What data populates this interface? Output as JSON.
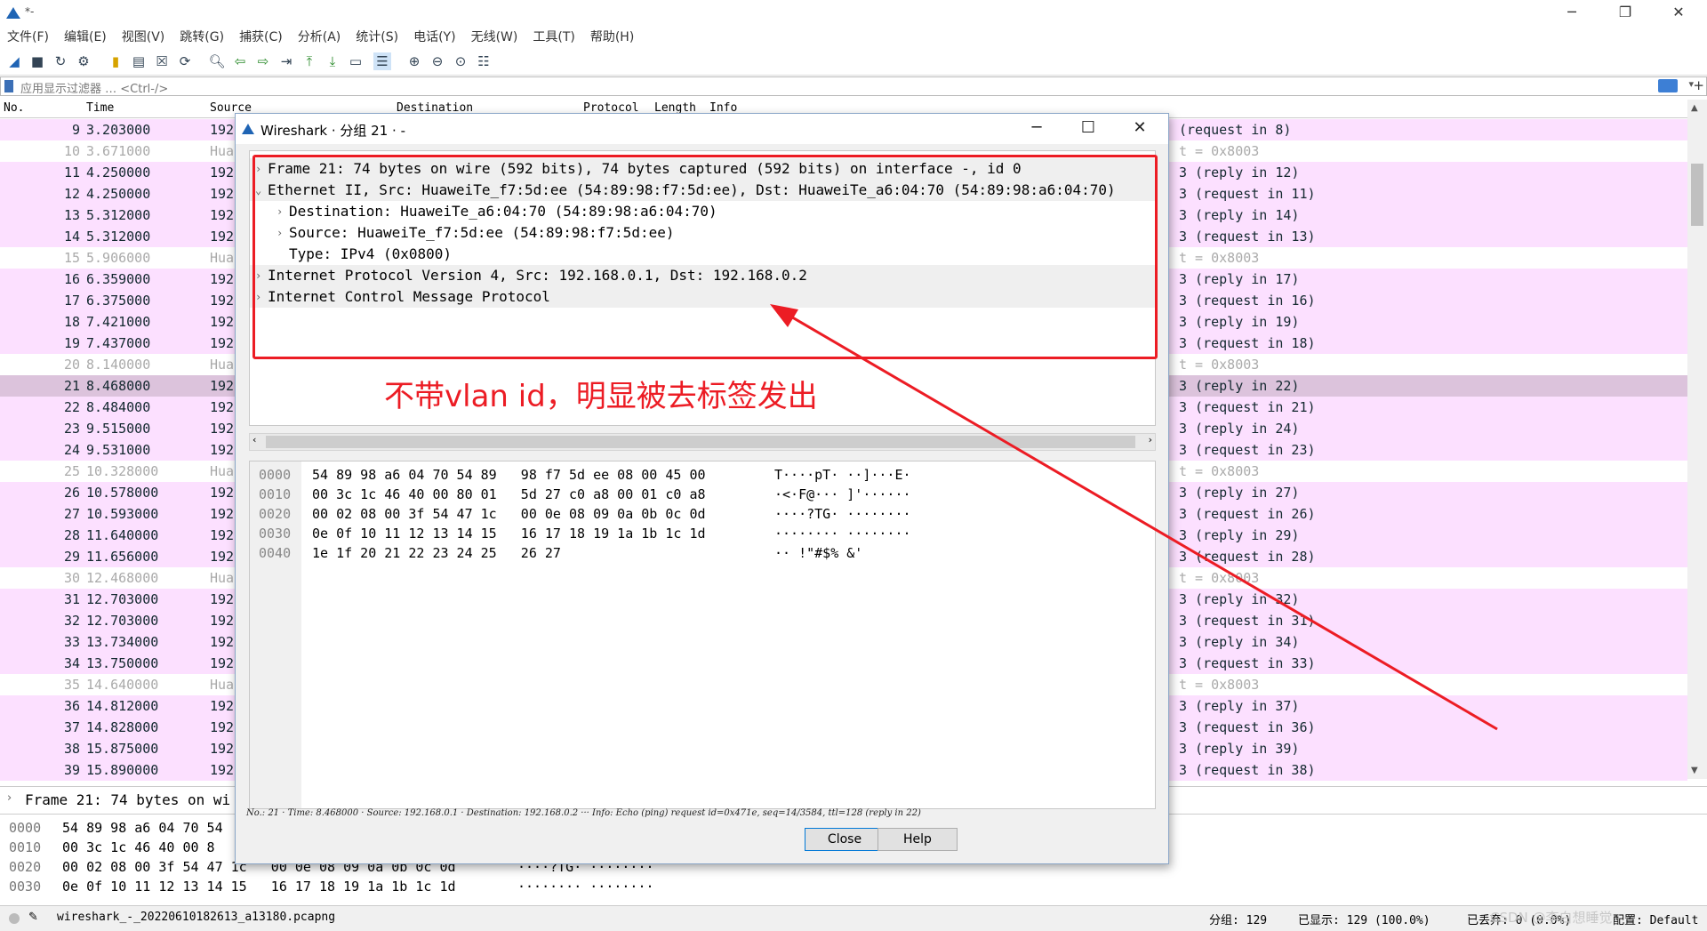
{
  "window": {
    "title": "*-"
  },
  "menu": [
    "文件(F)",
    "编辑(E)",
    "视图(V)",
    "跳转(G)",
    "捕获(C)",
    "分析(A)",
    "统计(S)",
    "电话(Y)",
    "无线(W)",
    "工具(T)",
    "帮助(H)"
  ],
  "filter": {
    "placeholder": "应用显示过滤器 … <Ctrl-/>"
  },
  "columns": [
    "No.",
    "Time",
    "Source",
    "Destination",
    "Protocol",
    "Length",
    "Info"
  ],
  "packets": [
    {
      "no": "9",
      "time": "3.203000",
      "src": "192",
      "info": "(request in 8)",
      "kind": "icmp"
    },
    {
      "no": "10",
      "time": "3.671000",
      "src": "Hua",
      "info": "t = 0x8003",
      "kind": "other"
    },
    {
      "no": "11",
      "time": "4.250000",
      "src": "192",
      "info": "3 (reply in 12)",
      "kind": "icmp"
    },
    {
      "no": "12",
      "time": "4.250000",
      "src": "192",
      "info": "3 (request in 11)",
      "kind": "icmp"
    },
    {
      "no": "13",
      "time": "5.312000",
      "src": "192",
      "info": "3 (reply in 14)",
      "kind": "icmp"
    },
    {
      "no": "14",
      "time": "5.312000",
      "src": "192",
      "info": "3 (request in 13)",
      "kind": "icmp"
    },
    {
      "no": "15",
      "time": "5.906000",
      "src": "Hua",
      "info": "t = 0x8003",
      "kind": "other"
    },
    {
      "no": "16",
      "time": "6.359000",
      "src": "192",
      "info": "3 (reply in 17)",
      "kind": "icmp"
    },
    {
      "no": "17",
      "time": "6.375000",
      "src": "192",
      "info": "3 (request in 16)",
      "kind": "icmp"
    },
    {
      "no": "18",
      "time": "7.421000",
      "src": "192",
      "info": "3 (reply in 19)",
      "kind": "icmp"
    },
    {
      "no": "19",
      "time": "7.437000",
      "src": "192",
      "info": "3 (request in 18)",
      "kind": "icmp"
    },
    {
      "no": "20",
      "time": "8.140000",
      "src": "Hua",
      "info": "t = 0x8003",
      "kind": "other"
    },
    {
      "no": "21",
      "time": "8.468000",
      "src": "192",
      "info": "3 (reply in 22)",
      "kind": "sel"
    },
    {
      "no": "22",
      "time": "8.484000",
      "src": "192",
      "info": "3 (request in 21)",
      "kind": "icmp"
    },
    {
      "no": "23",
      "time": "9.515000",
      "src": "192",
      "info": "3 (reply in 24)",
      "kind": "icmp"
    },
    {
      "no": "24",
      "time": "9.531000",
      "src": "192",
      "info": "3 (request in 23)",
      "kind": "icmp"
    },
    {
      "no": "25",
      "time": "10.328000",
      "src": "Hua",
      "info": "t = 0x8003",
      "kind": "other"
    },
    {
      "no": "26",
      "time": "10.578000",
      "src": "192",
      "info": "3 (reply in 27)",
      "kind": "icmp"
    },
    {
      "no": "27",
      "time": "10.593000",
      "src": "192",
      "info": "3 (request in 26)",
      "kind": "icmp"
    },
    {
      "no": "28",
      "time": "11.640000",
      "src": "192",
      "info": "3 (reply in 29)",
      "kind": "icmp"
    },
    {
      "no": "29",
      "time": "11.656000",
      "src": "192",
      "info": "3 (request in 28)",
      "kind": "icmp"
    },
    {
      "no": "30",
      "time": "12.468000",
      "src": "Hua",
      "info": "t = 0x8003",
      "kind": "other"
    },
    {
      "no": "31",
      "time": "12.703000",
      "src": "192",
      "info": "3 (reply in 32)",
      "kind": "icmp"
    },
    {
      "no": "32",
      "time": "12.703000",
      "src": "192",
      "info": "3 (request in 31)",
      "kind": "icmp"
    },
    {
      "no": "33",
      "time": "13.734000",
      "src": "192",
      "info": "3 (reply in 34)",
      "kind": "icmp"
    },
    {
      "no": "34",
      "time": "13.750000",
      "src": "192",
      "info": "3 (request in 33)",
      "kind": "icmp"
    },
    {
      "no": "35",
      "time": "14.640000",
      "src": "Hua",
      "info": "t = 0x8003",
      "kind": "other"
    },
    {
      "no": "36",
      "time": "14.812000",
      "src": "192",
      "info": "3 (reply in 37)",
      "kind": "icmp"
    },
    {
      "no": "37",
      "time": "14.828000",
      "src": "192",
      "info": "3 (request in 36)",
      "kind": "icmp"
    },
    {
      "no": "38",
      "time": "15.875000",
      "src": "192",
      "info": "3 (reply in 39)",
      "kind": "icmp"
    },
    {
      "no": "39",
      "time": "15.890000",
      "src": "192",
      "info": "3 (request in 38)",
      "kind": "icmp"
    }
  ],
  "detail": {
    "summary": "Frame 21: 74 bytes on wi"
  },
  "bytes": [
    {
      "off": "0000",
      "hex": "54 89 98 a6 04 70 54",
      "asc": ""
    },
    {
      "off": "0010",
      "hex": "00 3c 1c 46 40 00 8",
      "asc": ""
    },
    {
      "off": "0020",
      "hex": "00 02 08 00 3f 54 47 1c   00 0e 08 09 0a 0b 0c 0d",
      "asc": "····?TG· ········"
    },
    {
      "off": "0030",
      "hex": "0e 0f 10 11 12 13 14 15   16 17 18 19 1a 1b 1c 1d",
      "asc": "········ ········"
    }
  ],
  "status": {
    "file": "wireshark_-_20220610182613_a13180.pcapng",
    "packets": "分组: 129",
    "displayed": "已显示: 129 (100.0%)",
    "dropped": "已丢弃: 0 (0.0%)",
    "profile": "配置: Default",
    "watermark": "CSDN @李白想睡觉"
  },
  "dialog": {
    "title": "Wireshark · 分组 21 · -",
    "tree": [
      {
        "text": "Frame 21: 74 bytes on wire (592 bits), 74 bytes captured (592 bits) on interface -, id 0",
        "indent": 0,
        "expander": "›",
        "top": true
      },
      {
        "text": "Ethernet II, Src: HuaweiTe_f7:5d:ee (54:89:98:f7:5d:ee), Dst: HuaweiTe_a6:04:70 (54:89:98:a6:04:70)",
        "indent": 0,
        "expander": "⌄",
        "top": true
      },
      {
        "text": "Destination: HuaweiTe_a6:04:70 (54:89:98:a6:04:70)",
        "indent": 1,
        "expander": "›",
        "top": false
      },
      {
        "text": "Source: HuaweiTe_f7:5d:ee (54:89:98:f7:5d:ee)",
        "indent": 1,
        "expander": "›",
        "top": false
      },
      {
        "text": "Type: IPv4 (0x0800)",
        "indent": 1,
        "expander": "",
        "top": false
      },
      {
        "text": "Internet Protocol Version 4, Src: 192.168.0.1, Dst: 192.168.0.2",
        "indent": 0,
        "expander": "›",
        "top": true
      },
      {
        "text": "Internet Control Message Protocol",
        "indent": 0,
        "expander": "›",
        "top": true
      }
    ],
    "bytes": [
      {
        "off": "0000",
        "hex": "54 89 98 a6 04 70 54 89   98 f7 5d ee 08 00 45 00",
        "asc": "T····pT· ··]···E·"
      },
      {
        "off": "0010",
        "hex": "00 3c 1c 46 40 00 80 01   5d 27 c0 a8 00 01 c0 a8",
        "asc": "·<·F@··· ]'······"
      },
      {
        "off": "0020",
        "hex": "00 02 08 00 3f 54 47 1c   00 0e 08 09 0a 0b 0c 0d",
        "asc": "····?TG· ········"
      },
      {
        "off": "0030",
        "hex": "0e 0f 10 11 12 13 14 15   16 17 18 19 1a 1b 1c 1d",
        "asc": "········ ········"
      },
      {
        "off": "0040",
        "hex": "1e 1f 20 21 22 23 24 25   26 27",
        "asc": "·· !\"#$% &'"
      }
    ],
    "status": "No.: 21 · Time: 8.468000 · Source: 192.168.0.1 · Destination: 192.168.0.2 ··· Info: Echo (ping) request id=0x471e, seq=14/3584, ttl=128 (reply in 22)",
    "close_label": "Close",
    "help_label": "Help"
  },
  "annotation": {
    "text": "不带vlan id，明显被去标签发出",
    "color": "#ec1c24"
  }
}
